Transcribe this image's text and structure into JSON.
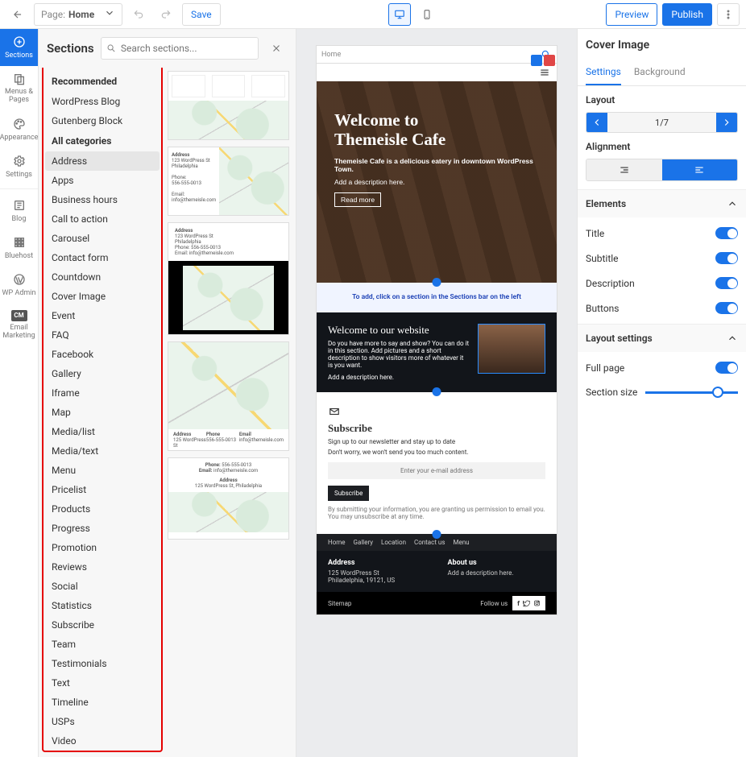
{
  "topbar": {
    "page_prefix": "Page:",
    "page_name": "Home",
    "save": "Save",
    "preview": "Preview",
    "publish": "Publish"
  },
  "rail": {
    "sections": "Sections",
    "menus": "Menus & Pages",
    "appearance": "Appearance",
    "settings": "Settings",
    "blog": "Blog",
    "bluehost": "Bluehost",
    "wpadmin": "WP Admin",
    "emailmkt": "Email Marketing"
  },
  "sections_panel": {
    "title": "Sections",
    "search_placeholder": "Search sections...",
    "recommended_head": "Recommended",
    "recommended": [
      "WordPress Blog",
      "Gutenberg Block"
    ],
    "allcat_head": "All categories",
    "allcats": [
      "Address",
      "Apps",
      "Business hours",
      "Call to action",
      "Carousel",
      "Contact form",
      "Countdown",
      "Cover Image",
      "Event",
      "FAQ",
      "Facebook",
      "Gallery",
      "Iframe",
      "Map",
      "Media/list",
      "Media/text",
      "Menu",
      "Pricelist",
      "Products",
      "Progress",
      "Promotion",
      "Reviews",
      "Social",
      "Statistics",
      "Subscribe",
      "Team",
      "Testimonials",
      "Text",
      "Timeline",
      "USPs",
      "Video"
    ],
    "active_cat_index": 0
  },
  "canvas": {
    "address_label": "Home",
    "hero_title_a": "Welcome to",
    "hero_title_b": "Themeisle Cafe",
    "hero_sub": "Themeisle Cafe is a delicious eatery in downtown WordPress Town.",
    "hero_desc": "Add a description here.",
    "hero_cta": "Read more",
    "hint": "To add, click on a section in the Sections bar on the left",
    "w2_title": "Welcome to our website",
    "w2_line1": "Do you have more to say and show? You can do it in this section. Add pictures and a short description to show visitors more of whatever it is you want.",
    "w2_line2": "Add a description here.",
    "sub_title": "Subscribe",
    "sub_line1": "Sign up to our newsletter and stay up to date",
    "sub_line2": "Don't worry, we won't send you too much content.",
    "sub_placeholder": "Enter your e-mail address",
    "sub_btn": "Subscribe",
    "sub_note": "By submitting your information, you are granting us permission to email you. You may unsubscribe at any time.",
    "ftr_nav": [
      "Home",
      "Gallery",
      "Location",
      "Contact us",
      "Menu"
    ],
    "addr_head": "Address",
    "addr_line1": "125 WordPress St",
    "addr_line2": "Philadelphia, 19121, US",
    "about_head": "About us",
    "about_line": "Add a description here.",
    "sitemap": "Sitemap",
    "follow": "Follow us"
  },
  "inspector": {
    "title": "Cover Image",
    "tab_settings": "Settings",
    "tab_background": "Background",
    "layout_label": "Layout",
    "layout_page": "1/7",
    "alignment_label": "Alignment",
    "elements_head": "Elements",
    "elements": [
      "Title",
      "Subtitle",
      "Description",
      "Buttons"
    ],
    "layoutset_head": "Layout settings",
    "fullpage": "Full page",
    "sectionsize": "Section size"
  }
}
